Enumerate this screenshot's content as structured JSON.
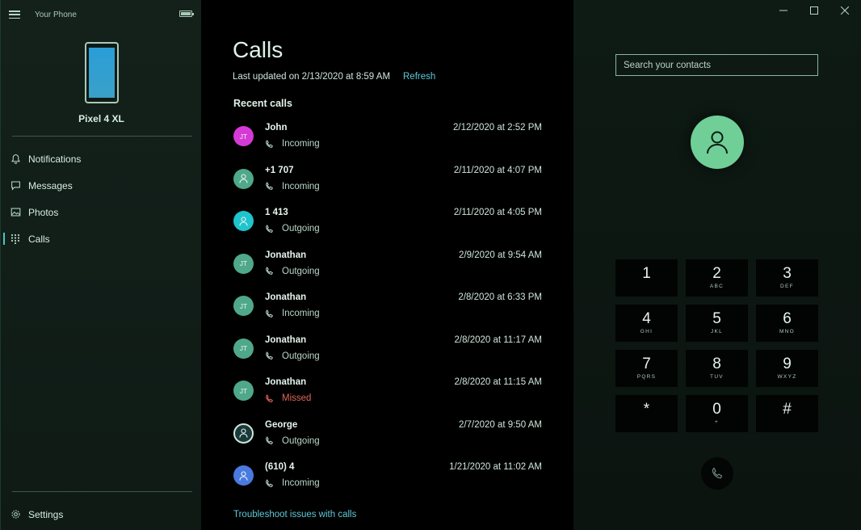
{
  "app": {
    "title": "Your Phone"
  },
  "device": {
    "name": "Pixel 4 XL"
  },
  "nav": {
    "items": [
      {
        "label": "Notifications",
        "icon": "bell-icon",
        "active": false
      },
      {
        "label": "Messages",
        "icon": "message-icon",
        "active": false
      },
      {
        "label": "Photos",
        "icon": "photos-icon",
        "active": false
      },
      {
        "label": "Calls",
        "icon": "dialpad-icon",
        "active": true
      }
    ],
    "settings_label": "Settings"
  },
  "calls": {
    "title": "Calls",
    "last_updated": "Last updated on 2/13/2020 at 8:59 AM",
    "refresh_label": "Refresh",
    "recent_title": "Recent calls",
    "troubleshoot_label": "Troubleshoot issues with calls",
    "items": [
      {
        "name": "John",
        "type": "Incoming",
        "time": "2/12/2020 at 2:52 PM",
        "avatar_text": "JT",
        "avatar_color": "#d63ad6"
      },
      {
        "name": "+1 707",
        "type": "Incoming",
        "time": "2/11/2020 at 4:07 PM",
        "avatar_text": "",
        "avatar_color": "#4fa88a"
      },
      {
        "name": "1 413",
        "type": "Outgoing",
        "time": "2/11/2020 at 4:05 PM",
        "avatar_text": "",
        "avatar_color": "#1fc4cc"
      },
      {
        "name": "Jonathan",
        "type": "Outgoing",
        "time": "2/9/2020 at 9:54 AM",
        "avatar_text": "JT",
        "avatar_color": "#4fa88a"
      },
      {
        "name": "Jonathan",
        "type": "Incoming",
        "time": "2/8/2020 at 6:33 PM",
        "avatar_text": "JT",
        "avatar_color": "#4fa88a"
      },
      {
        "name": "Jonathan",
        "type": "Outgoing",
        "time": "2/8/2020 at 11:17 AM",
        "avatar_text": "JT",
        "avatar_color": "#4fa88a"
      },
      {
        "name": "Jonathan",
        "type": "Missed",
        "time": "2/8/2020 at 11:15 AM",
        "avatar_text": "JT",
        "avatar_color": "#4fa88a"
      },
      {
        "name": "George",
        "type": "Outgoing",
        "time": "2/7/2020 at 9:50 AM",
        "avatar_text": "",
        "avatar_color": "#1a3a3a"
      },
      {
        "name": "(610) 4",
        "type": "Incoming",
        "time": "1/21/2020 at 11:02 AM",
        "avatar_text": "",
        "avatar_color": "#4a7ae0"
      }
    ]
  },
  "dialer": {
    "search_placeholder": "Search your contacts",
    "keys": [
      {
        "digit": "1",
        "letters": ""
      },
      {
        "digit": "2",
        "letters": "ABC"
      },
      {
        "digit": "3",
        "letters": "DEF"
      },
      {
        "digit": "4",
        "letters": "GHI"
      },
      {
        "digit": "5",
        "letters": "JKL"
      },
      {
        "digit": "6",
        "letters": "MNO"
      },
      {
        "digit": "7",
        "letters": "PQRS"
      },
      {
        "digit": "8",
        "letters": "TUV"
      },
      {
        "digit": "9",
        "letters": "WXYZ"
      },
      {
        "digit": "*",
        "letters": ""
      },
      {
        "digit": "0",
        "letters": "+"
      },
      {
        "digit": "#",
        "letters": ""
      }
    ]
  },
  "colors": {
    "accent": "#5fc9d6",
    "missed": "#e0655a",
    "contact_avatar": "#6fcf97"
  }
}
